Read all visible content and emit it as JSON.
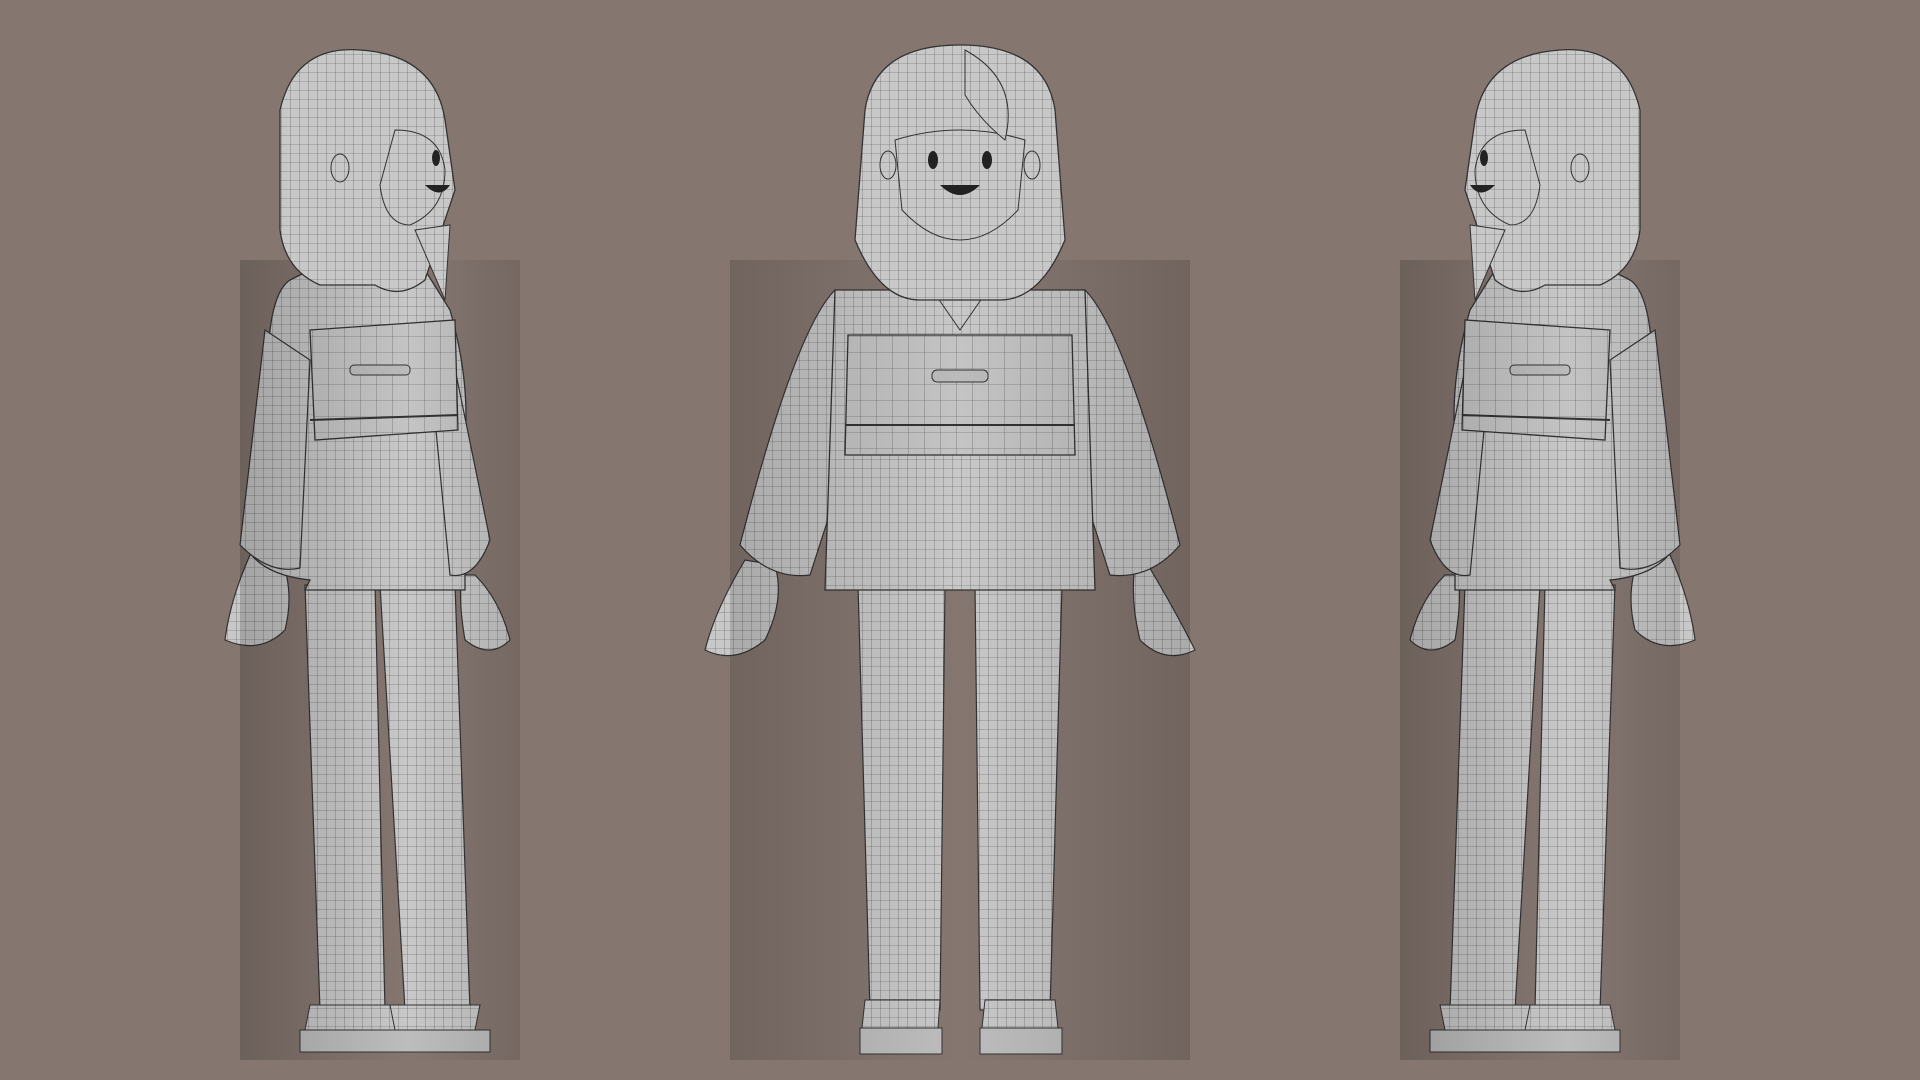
{
  "scene": {
    "background_color": "#857670",
    "mesh_color": "#c9c9c9",
    "mesh_shadow_color": "#9a9a9a",
    "wire_color": "#3a3a3a",
    "views": [
      {
        "name": "left-three-quarter-view",
        "facing": "right"
      },
      {
        "name": "front-view",
        "facing": "front"
      },
      {
        "name": "right-three-quarter-view",
        "facing": "left"
      }
    ]
  }
}
